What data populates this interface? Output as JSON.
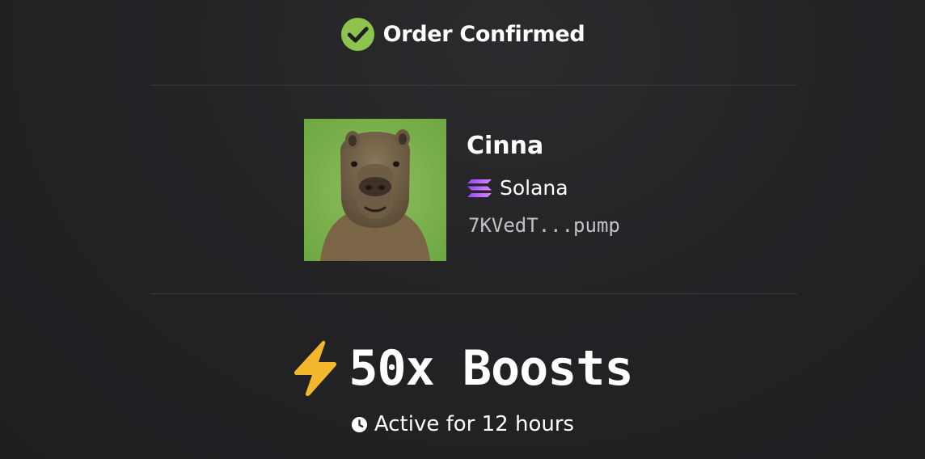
{
  "header": {
    "title": "Order Confirmed",
    "icon": "check-circle-icon",
    "icon_color": "#8cc44e"
  },
  "token": {
    "name": "Cinna",
    "image": "capybara-avatar",
    "chain": {
      "name": "Solana",
      "icon": "solana-icon"
    },
    "address": "7KVedT...pump"
  },
  "boost": {
    "label": "50x Boosts",
    "icon": "lightning-bolt-icon",
    "icon_color": "#f3b72d"
  },
  "duration": {
    "label": "Active for 12 hours",
    "icon": "clock-icon"
  },
  "colors": {
    "background": "#232326",
    "divider": "#3a3a3e",
    "text": "#ffffff",
    "muted_text": "#c2c2c6"
  }
}
